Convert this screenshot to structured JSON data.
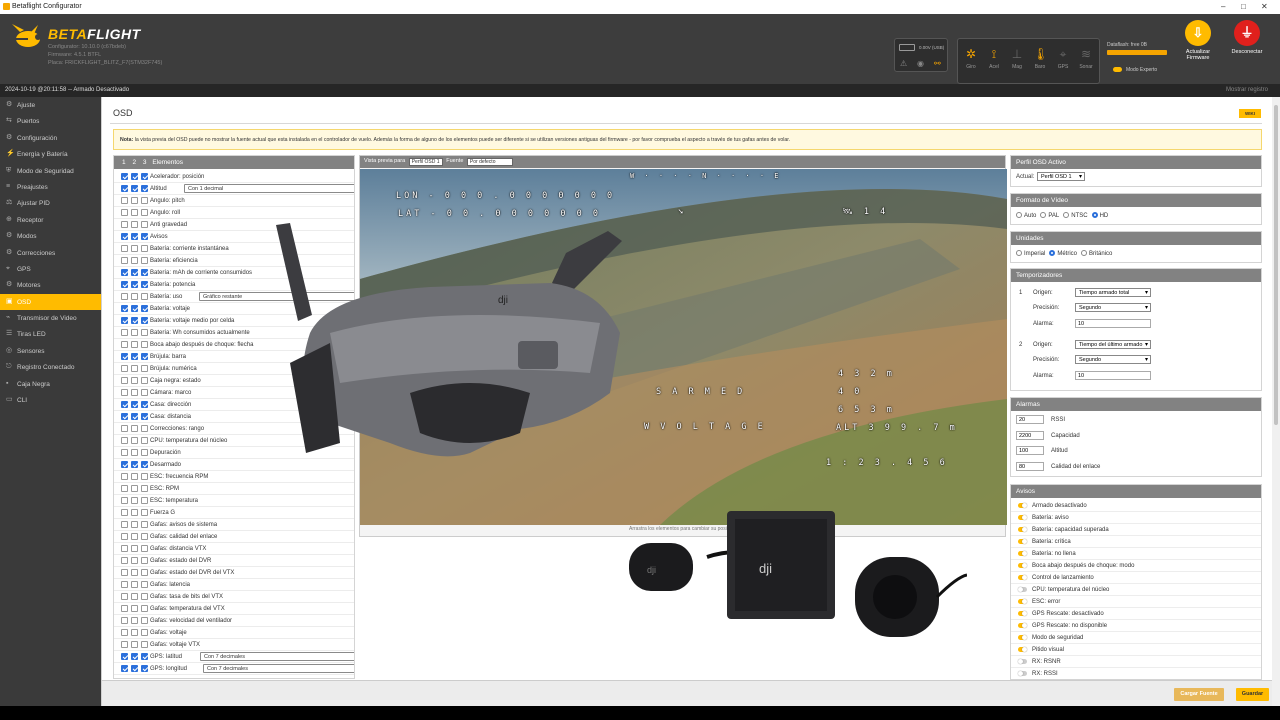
{
  "window": {
    "title": "Betaflight Configurator",
    "controls": [
      "–",
      "□",
      "✕"
    ]
  },
  "brand": {
    "name_a": "BETA",
    "name_b": "FLIGHT",
    "configurator": "Configurator: 10.10.0 (c67bdeb)",
    "firmware": "Firmware: 4.5.1 BTFL",
    "board": "Placa: FRICKFLIGHT_BLITZ_F7(STM32F745)"
  },
  "battery": {
    "label": "0.00V (USB)"
  },
  "sensors": [
    {
      "name": "Giro",
      "icon": "gyro-icon"
    },
    {
      "name": "Acel",
      "icon": "accel-icon"
    },
    {
      "name": "Mag",
      "icon": "mag-icon"
    },
    {
      "name": "Baro",
      "icon": "baro-icon"
    },
    {
      "name": "GPS",
      "icon": "gps-icon"
    },
    {
      "name": "Sonar",
      "icon": "sonar-icon"
    }
  ],
  "dataflash": {
    "label": "Dataflash: free 0B"
  },
  "expert": {
    "label": "Modo Experto"
  },
  "update_firmware": {
    "label_1": "Actualizar",
    "label_2": "Firmware"
  },
  "disconnect": {
    "label": "Desconectar"
  },
  "status": {
    "left": "2024-10-19 @20:11:58 -- Armado Desactivado",
    "right": "Mostrar registro"
  },
  "nav": [
    "Ajuste",
    "Puertos",
    "Configuración",
    "Energía y Batería",
    "Modo de Seguridad",
    "Preajustes",
    "Ajustar PID",
    "Receptor",
    "Modos",
    "Correcciones",
    "GPS",
    "Motores",
    "OSD",
    "Transmisor de Video",
    "Tiras LED",
    "Sensores",
    "Registro Conectado",
    "Caja Negra",
    "CLI"
  ],
  "nav_active": "OSD",
  "page": {
    "title": "OSD",
    "wiki": "WIKI",
    "note_bold": "Nota:",
    "note": "la vista previa del OSD puede no mostrar la fuente actual que esta instalada en el controlador de vuelo. Además la forma de alguno de los elementos puede ser diferente si se utilizan versiones antiguas del firmware - por favor comprueba el aspecto a través de tus gafas antes de volar."
  },
  "elements": {
    "header": {
      "p1": "1",
      "p2": "2",
      "p3": "3",
      "label": "Elementos"
    },
    "rows": [
      {
        "label": "Acelerador: posición",
        "c": [
          1,
          1,
          1
        ]
      },
      {
        "label": "Altitud",
        "c": [
          1,
          1,
          1
        ],
        "select": "Con 1 decimal"
      },
      {
        "label": "Angulo: pitch",
        "c": [
          0,
          0,
          0
        ]
      },
      {
        "label": "Angulo: roll",
        "c": [
          0,
          0,
          0
        ]
      },
      {
        "label": "Anti gravedad",
        "c": [
          0,
          0,
          0
        ]
      },
      {
        "label": "Avisos",
        "c": [
          1,
          1,
          1
        ]
      },
      {
        "label": "Batería: corriente instantánea",
        "c": [
          0,
          0,
          0
        ]
      },
      {
        "label": "Batería: eficiencia",
        "c": [
          0,
          0,
          0
        ]
      },
      {
        "label": "Batería: mAh de corriente consumidos",
        "c": [
          1,
          1,
          1
        ]
      },
      {
        "label": "Batería: potencia",
        "c": [
          1,
          1,
          1
        ]
      },
      {
        "label": "Batería: uso",
        "c": [
          0,
          0,
          0
        ],
        "select": "Gráfico restante"
      },
      {
        "label": "Batería: voltaje",
        "c": [
          1,
          1,
          1
        ]
      },
      {
        "label": "Batería: voltaje medio por celda",
        "c": [
          1,
          1,
          1
        ]
      },
      {
        "label": "Batería: Wh consumidos actualmente",
        "c": [
          0,
          0,
          0
        ]
      },
      {
        "label": "Boca abajo después de choque: flecha",
        "c": [
          0,
          0,
          0
        ]
      },
      {
        "label": "Brújula: barra",
        "c": [
          1,
          1,
          1
        ]
      },
      {
        "label": "Brújula: numérica",
        "c": [
          0,
          0,
          0
        ]
      },
      {
        "label": "Caja negra: estado",
        "c": [
          0,
          0,
          0
        ]
      },
      {
        "label": "Cámara: marco",
        "c": [
          0,
          0,
          0
        ]
      },
      {
        "label": "Casa: dirección",
        "c": [
          1,
          1,
          1
        ]
      },
      {
        "label": "Casa: distancia",
        "c": [
          1,
          1,
          1
        ]
      },
      {
        "label": "Correcciones: rango",
        "c": [
          0,
          0,
          0
        ]
      },
      {
        "label": "CPU: temperatura del núcleo",
        "c": [
          0,
          0,
          0
        ]
      },
      {
        "label": "Depuración",
        "c": [
          0,
          0,
          0
        ]
      },
      {
        "label": "Desarmado",
        "c": [
          1,
          1,
          1
        ]
      },
      {
        "label": "ESC: frecuencia RPM",
        "c": [
          0,
          0,
          0
        ]
      },
      {
        "label": "ESC: RPM",
        "c": [
          0,
          0,
          0
        ]
      },
      {
        "label": "ESC: temperatura",
        "c": [
          0,
          0,
          0
        ]
      },
      {
        "label": "Fuerza G",
        "c": [
          0,
          0,
          0
        ]
      },
      {
        "label": "Gafas: avisos de sistema",
        "c": [
          0,
          0,
          0
        ]
      },
      {
        "label": "Gafas: calidad del enlace",
        "c": [
          0,
          0,
          0
        ]
      },
      {
        "label": "Gafas: distancia VTX",
        "c": [
          0,
          0,
          0
        ]
      },
      {
        "label": "Gafas: estado del DVR",
        "c": [
          0,
          0,
          0
        ]
      },
      {
        "label": "Gafas: estado del DVR del VTX",
        "c": [
          0,
          0,
          0
        ]
      },
      {
        "label": "Gafas: latencia",
        "c": [
          0,
          0,
          0
        ]
      },
      {
        "label": "Gafas: tasa de bits del VTX",
        "c": [
          0,
          0,
          0
        ]
      },
      {
        "label": "Gafas: temperatura del VTX",
        "c": [
          0,
          0,
          0
        ]
      },
      {
        "label": "Gafas: velocidad del ventilador",
        "c": [
          0,
          0,
          0
        ]
      },
      {
        "label": "Gafas: voltaje",
        "c": [
          0,
          0,
          0
        ]
      },
      {
        "label": "Gafas: voltaje VTX",
        "c": [
          0,
          0,
          0
        ]
      },
      {
        "label": "GPS: latitud",
        "c": [
          1,
          1,
          1
        ],
        "select": "Con 7 decimales"
      },
      {
        "label": "GPS: longitud",
        "c": [
          1,
          1,
          1
        ],
        "select": "Con 7 decimales"
      }
    ]
  },
  "preview": {
    "label_preview": "Vista previa para",
    "preview_sel": "Perfil OSD 1",
    "label_font": "Fuente",
    "font_sel": "Por defecto",
    "drag_note": "Arrastra los elementos para cambiar su posición"
  },
  "osd": {
    "lon": "LON - 0 0 0 . 0 0 0 0 0 0 0",
    "lat": "LAT - 0 0 . 0 0 0 0 0 0 0",
    "compass": "W · · · · N · · · · E",
    "sats": "1 4",
    "armed": "S A R M E D",
    "voltage": "W  V O L T A G E",
    "dist1": "4 3 2 m",
    "dist2": "4 0",
    "dist3": "6 5 3 m",
    "alt": "ALT 3 9 9 . 7 m",
    "timer": "1 : 2 3 . 4 5 6"
  },
  "right": {
    "profile": {
      "title": "Perfil OSD Activo",
      "label": "Actual:",
      "value": "Perfil OSD 1"
    },
    "video": {
      "title": "Formato de Vídeo",
      "options": [
        "Auto",
        "PAL",
        "NTSC",
        "HD"
      ],
      "selected": "HD"
    },
    "units": {
      "title": "Unidades",
      "options": [
        "Imperial",
        "Métrico",
        "Británico"
      ],
      "selected": "Métrico"
    },
    "timers": {
      "title": "Temporizadores",
      "items": [
        {
          "n": "1",
          "origen_l": "Origen:",
          "origen": "Tiempo armado total",
          "prec_l": "Precisión:",
          "prec": "Segundo",
          "alarm_l": "Alarma:",
          "alarm": "10"
        },
        {
          "n": "2",
          "origen_l": "Origen:",
          "origen": "Tiempo del último armado",
          "prec_l": "Precisión:",
          "prec": "Segundo",
          "alarm_l": "Alarma:",
          "alarm": "10"
        }
      ]
    },
    "alarms": {
      "title": "Alarmas",
      "items": [
        {
          "v": "20",
          "l": "RSSI"
        },
        {
          "v": "2200",
          "l": "Capacidad"
        },
        {
          "v": "100",
          "l": "Altitud"
        },
        {
          "v": "80",
          "l": "Calidad del enlace"
        }
      ]
    },
    "warnings": {
      "title": "Avisos",
      "items": [
        {
          "l": "Armado desactivado",
          "on": true
        },
        {
          "l": "Batería: aviso",
          "on": true
        },
        {
          "l": "Batería: capacidad superada",
          "on": true
        },
        {
          "l": "Batería: crítica",
          "on": true
        },
        {
          "l": "Batería: no llena",
          "on": true
        },
        {
          "l": "Boca abajo después de choque: modo",
          "on": true
        },
        {
          "l": "Control de lanzamiento",
          "on": true
        },
        {
          "l": "CPU: temperatura del núcleo",
          "on": false
        },
        {
          "l": "ESC: error",
          "on": true
        },
        {
          "l": "GPS Rescate: desactivado",
          "on": true
        },
        {
          "l": "GPS Rescate: no disponible",
          "on": true
        },
        {
          "l": "Modo de seguridad",
          "on": true
        },
        {
          "l": "Pitido visual",
          "on": true
        },
        {
          "l": "RX: RSNR",
          "on": false
        },
        {
          "l": "RX: RSSI",
          "on": false
        }
      ]
    }
  },
  "footer": {
    "load_font": "Cargar Fuente",
    "save": "Guardar"
  },
  "colors": {
    "accent": "#ffbb00",
    "checkbox": "#2a6fdb",
    "disconnect": "#e0201c",
    "header_bg": "#3d3d3d"
  }
}
